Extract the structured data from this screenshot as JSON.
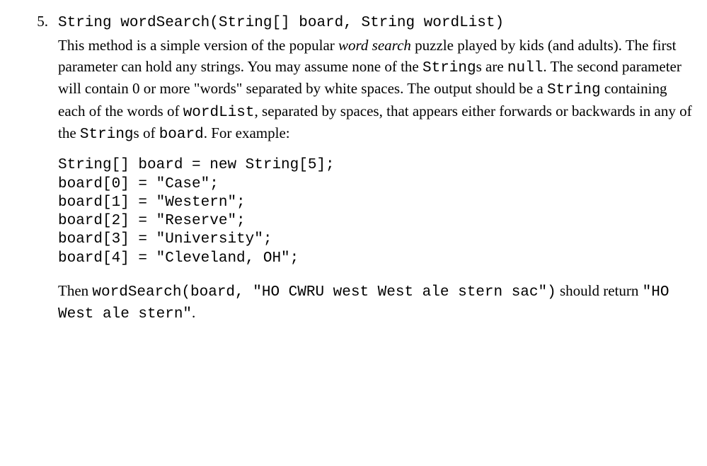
{
  "problem": {
    "number": "5.",
    "signature": "String wordSearch(String[] board, String wordList)",
    "desc_1a": "This method is a simple version of the popular ",
    "desc_1b_italic": "word search",
    "desc_1c": " puzzle played by kids (and adults). The first parameter can hold any strings. You may assume none of the ",
    "desc_1d_code": "String",
    "desc_1e": "s are ",
    "desc_1f_code": "null",
    "desc_1g": ". The second parameter will contain 0 or more \"words\" separated by white spaces. The output should be a ",
    "desc_1h_code": "String",
    "desc_1i": " containing each of the words of ",
    "desc_1j_code": "wordList",
    "desc_1k": ", separated by spaces, that appears either forwards or backwards in any of the ",
    "desc_1l_code": "String",
    "desc_1m": "s of ",
    "desc_1n_code": "board",
    "desc_1o": ". For example:",
    "code_line1": "String[] board = new String[5];",
    "code_line2": "board[0] = \"Case\";",
    "code_line3": "board[1] = \"Western\";",
    "code_line4": "board[2] = \"Reserve\";",
    "code_line5": "board[3] = \"University\";",
    "code_line6": "board[4] = \"Cleveland, OH\";",
    "then_a": "Then ",
    "then_b_code": "wordSearch(board, \"HO CWRU west West ale stern sac\")",
    "then_c": " should return ",
    "then_d_code": "\"HO West ale stern\"",
    "then_e": "."
  }
}
